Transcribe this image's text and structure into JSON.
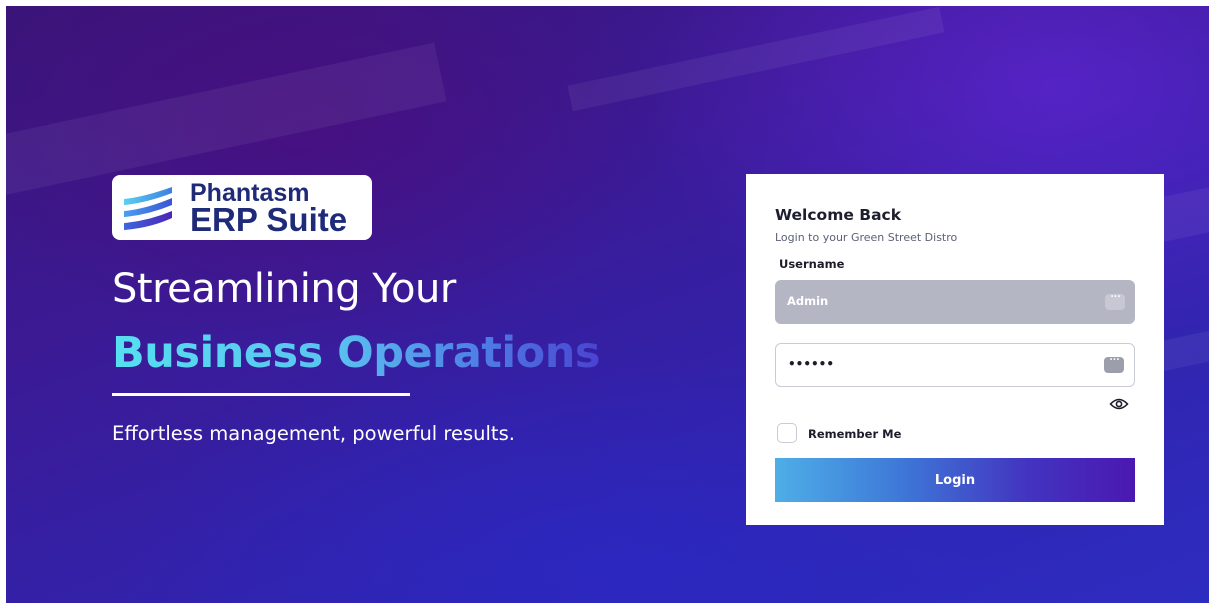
{
  "brand": {
    "line1": "Phantasm",
    "line2": "ERP Suite"
  },
  "hero": {
    "headline_line1": "Streamlining Your",
    "headline_line2": "Business Operations",
    "tagline": "Effortless management, powerful results."
  },
  "login_card": {
    "title": "Welcome Back",
    "subtitle": "Login to your Green Street Distro",
    "username_label": "Username",
    "username_value": "Admin",
    "password_value": "••••••",
    "remember_label": "Remember Me",
    "login_button": "Login"
  },
  "icons": {
    "logo": "logo-mark-icon",
    "password_manager": "password-manager-icon",
    "show_password": "eye-icon"
  },
  "colors": {
    "brand_navy": "#1f2a78",
    "accent_cyan": "#56e0f0",
    "accent_purple": "#4a18b0",
    "input_filled": "#b4b6c4"
  }
}
